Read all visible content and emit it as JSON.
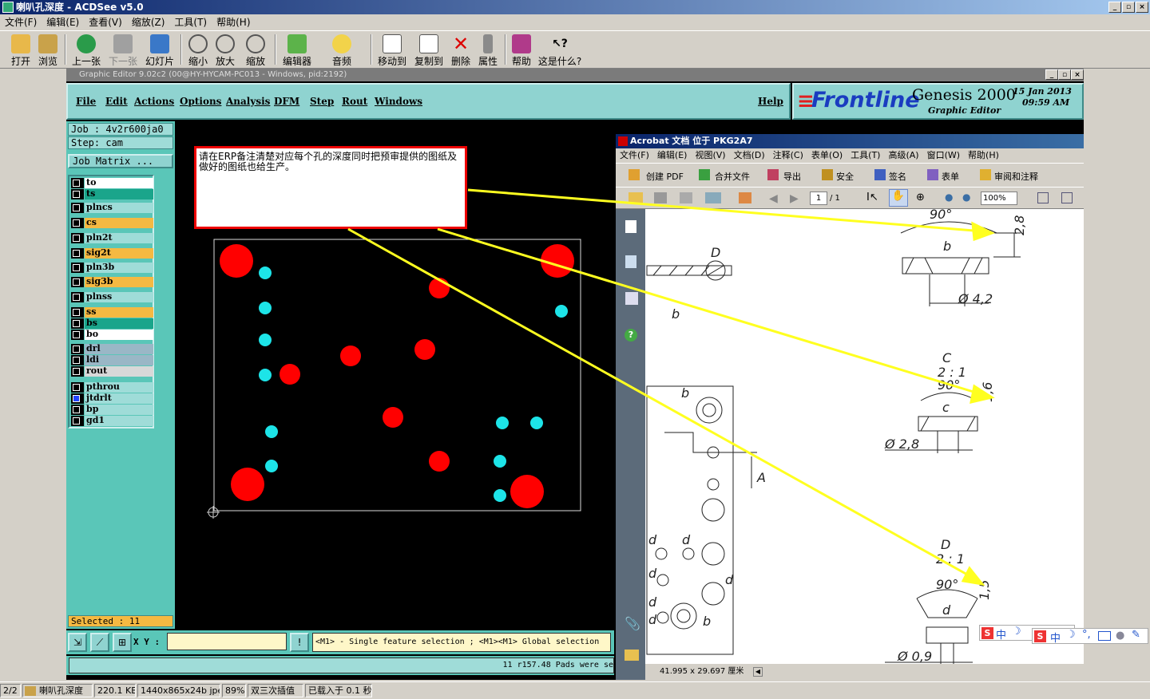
{
  "acdsee": {
    "title": "喇叭孔深度 - ACDSee v5.0",
    "menu": [
      "文件(F)",
      "编辑(E)",
      "查看(V)",
      "缩放(Z)",
      "工具(T)",
      "帮助(H)"
    ],
    "toolbar": [
      "打开",
      "浏览",
      "上一张",
      "下一张",
      "幻灯片",
      "缩小",
      "放大",
      "缩放",
      "编辑器",
      "音频",
      "移动到",
      "复制到",
      "删除",
      "属性",
      "帮助",
      "这是什么?"
    ],
    "status": [
      "2/2",
      "喇叭孔深度",
      "220.1 KB",
      "1440x865x24b jpeg",
      "89%",
      "双三次插值",
      "已载入于 0.1 秒"
    ]
  },
  "genesis": {
    "title": "Graphic Editor 9.02c2 (00@HY-HYCAM-PC013 - Windows, pid:2192)",
    "menu": [
      "File",
      "Edit",
      "Actions",
      "Options",
      "Analysis",
      "DFM",
      "Step",
      "Rout",
      "Windows"
    ],
    "help": "Help",
    "logo": {
      "brand": "Frontline",
      "product": "Genesis 2000",
      "subtitle": "Graphic Editor",
      "date": "15 Jan 2013",
      "time": "09:59 AM"
    },
    "job": "Job : 4v2r600ja0",
    "step": "Step: cam",
    "job_matrix": "Job Matrix ...",
    "layers": [
      {
        "name": "to",
        "color": "#ffffff"
      },
      {
        "name": "ts",
        "color": "#1aa58b"
      },
      {
        "name": "plncs",
        "color": "#9fdcd8"
      },
      {
        "name": "cs",
        "color": "#f5b942"
      },
      {
        "name": "pln2t",
        "color": "#9fdcd8"
      },
      {
        "name": "sig2t",
        "color": "#f5b942"
      },
      {
        "name": "pln3b",
        "color": "#9fdcd8"
      },
      {
        "name": "sig3b",
        "color": "#f5b942"
      },
      {
        "name": "plnss",
        "color": "#9fdcd8"
      },
      {
        "name": "ss",
        "color": "#f5b942"
      },
      {
        "name": "bs",
        "color": "#1aa58b"
      },
      {
        "name": "bo",
        "color": "#ffffff"
      },
      {
        "name": "drl",
        "color": "#9ab7c6"
      },
      {
        "name": "ldi",
        "color": "#9ab7c6"
      },
      {
        "name": "rout",
        "color": "#d8d8d8"
      },
      {
        "name": "pthrou",
        "color": "#9fdcd8"
      },
      {
        "name": "jtdrlt",
        "color": "#9fdcd8"
      },
      {
        "name": "bp",
        "color": "#9fdcd8"
      },
      {
        "name": "gd1",
        "color": "#9fdcd8"
      }
    ],
    "selected": "Selected : 11",
    "xy_label": "X Y :",
    "hint": "<M1> - Single feature selection ; <M1><M1> Global selection",
    "message": "11 r157.48 Pads were se"
  },
  "note": "请在ERP备注清楚对应每个孔的深度同时把预审提供的图纸及做好的图纸也给生产。",
  "acrobat": {
    "title": "Acrobat 文档 位于 PKG2A7",
    "menu": [
      "文件(F)",
      "编辑(E)",
      "视图(V)",
      "文档(D)",
      "注释(C)",
      "表单(O)",
      "工具(T)",
      "高级(A)",
      "窗口(W)",
      "帮助(H)"
    ],
    "toolbar": [
      "创建 PDF",
      "合并文件",
      "导出",
      "安全",
      "签名",
      "表单",
      "审阅和注释"
    ],
    "page": "1",
    "page_total": "/ 1",
    "zoom": "100%",
    "doc_size": "41.995 x 29.697 厘米",
    "drawing": {
      "labels": [
        "D",
        "b",
        "b",
        "C",
        "2 : 1",
        "c",
        "D",
        "2 : 1",
        "d",
        "A",
        "b",
        "d",
        "d",
        "d",
        "d",
        "d",
        "d",
        "b"
      ],
      "angles": [
        "90°",
        "90°",
        "90°"
      ],
      "depths": [
        "2,8",
        "1,6",
        "1,5"
      ],
      "diameters": [
        "Ø 4,2",
        "Ø 2,8",
        "Ø 0,9"
      ]
    }
  },
  "ime": [
    "中",
    "中"
  ]
}
